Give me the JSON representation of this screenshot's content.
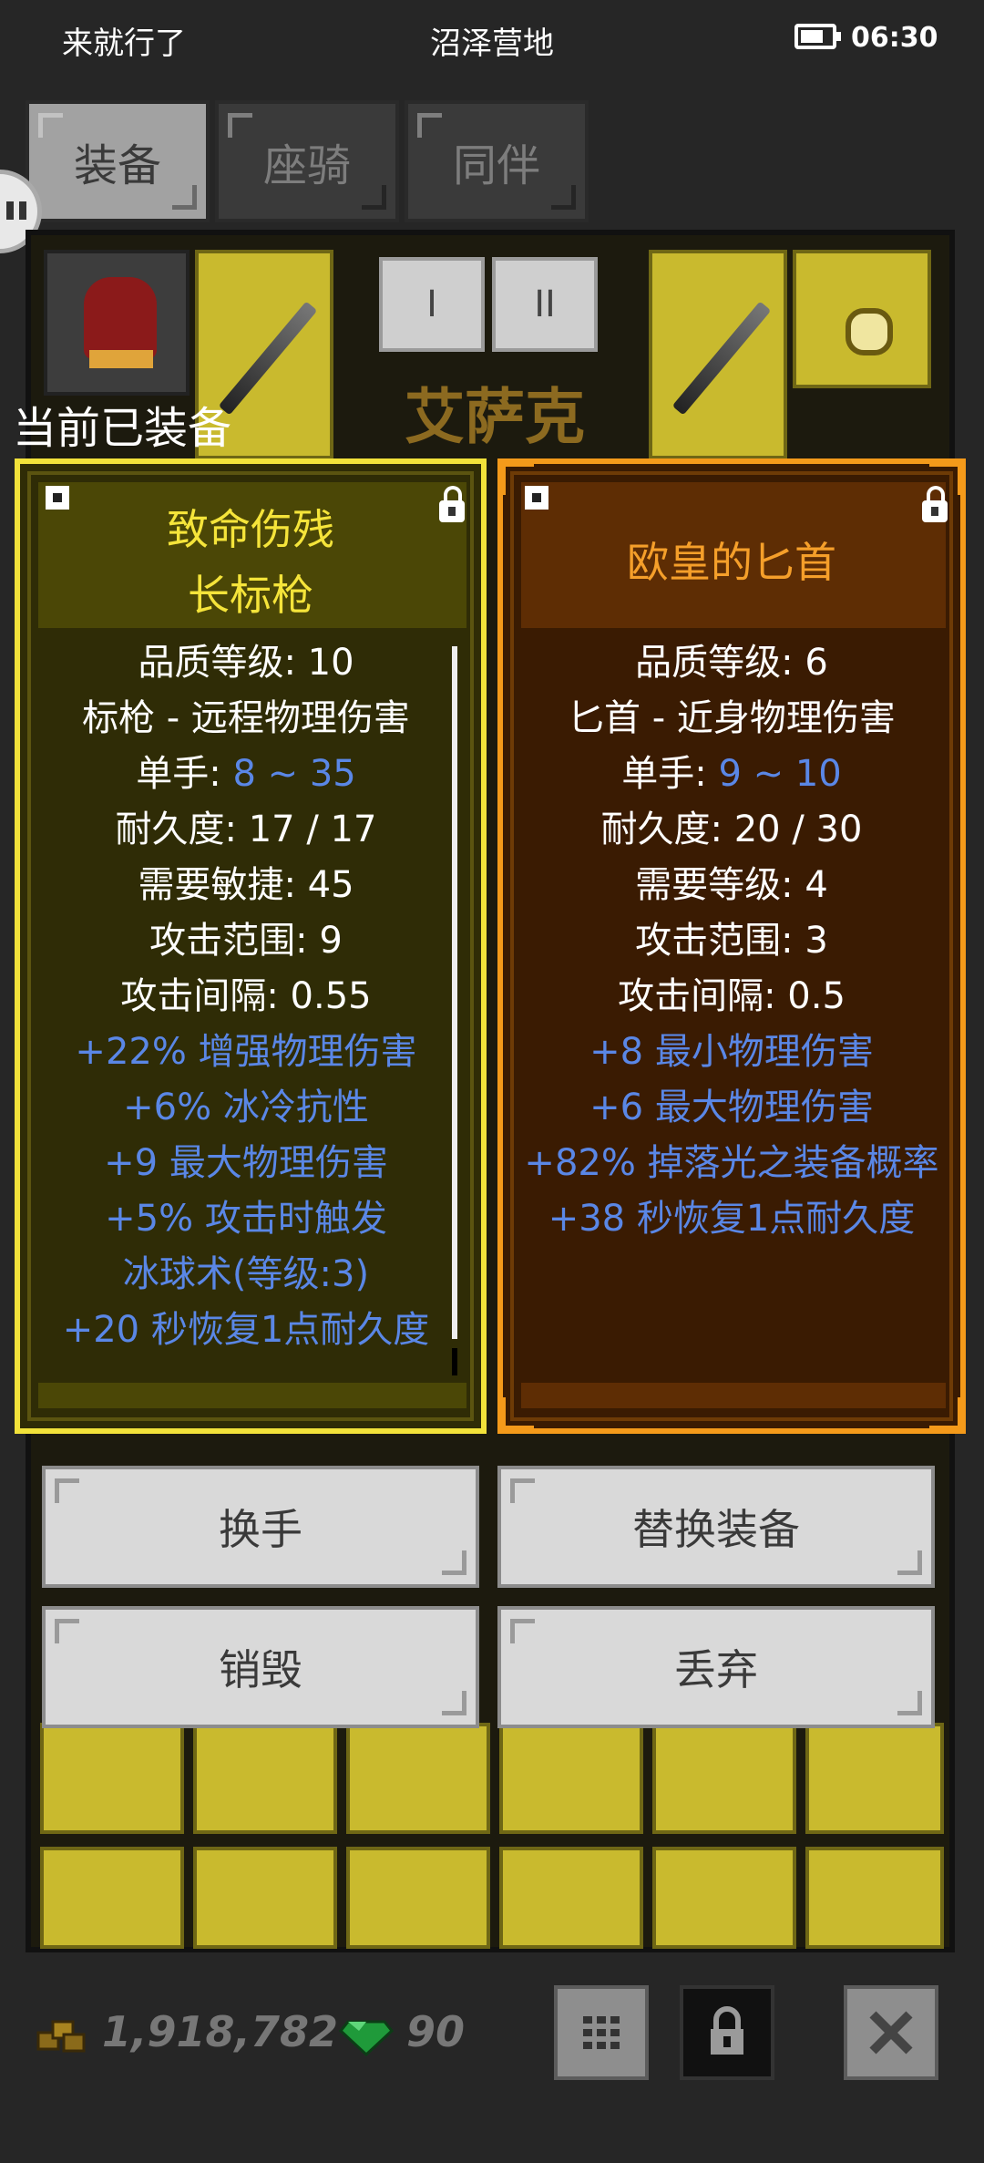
{
  "status": {
    "left": "来就行了",
    "center": "沼泽营地",
    "time": "06:30"
  },
  "tabs": [
    "装备",
    "座骑",
    "同伴"
  ],
  "character_name": "艾萨克",
  "set_buttons": [
    "I",
    "II"
  ],
  "current_equipped_label": "当前已装备",
  "equipped_item": {
    "title_line1": "致命伤残",
    "title_line2": "长标枪",
    "quality": "品质等级: 10",
    "type": "标枪 - 远程物理伤害",
    "hand_label": "单手: ",
    "damage": "8 ~ 35",
    "durability": "耐久度: 17 / 17",
    "requirement": "需要敏捷: 45",
    "range": "攻击范围: 9",
    "interval": "攻击间隔: 0.55",
    "affixes": [
      "+22% 增强物理伤害",
      "+6% 冰冷抗性",
      "+9 最大物理伤害",
      "+5% 攻击时触发",
      "冰球术(等级:3)",
      "+20 秒恢复1点耐久度"
    ]
  },
  "compare_item": {
    "title": "欧皇的匕首",
    "quality": "品质等级: 6",
    "type": "匕首 - 近身物理伤害",
    "hand_label": "单手: ",
    "damage": "9 ~ 10",
    "durability": "耐久度: 20 / 30",
    "requirement": "需要等级: 4",
    "range": "攻击范围: 3",
    "interval": "攻击间隔: 0.5",
    "affixes": [
      "+8 最小物理伤害",
      "+6 最大物理伤害",
      "+82% 掉落光之装备概率",
      "+38 秒恢复1点耐久度"
    ]
  },
  "actions": {
    "swap_hand": "换手",
    "replace": "替换装备",
    "destroy": "销毁",
    "discard": "丢弃"
  },
  "currency": {
    "gold": "1,918,782",
    "gems": "90"
  },
  "icons": {
    "grid": "grid-icon",
    "lock": "lock-icon",
    "close": "close-icon"
  }
}
